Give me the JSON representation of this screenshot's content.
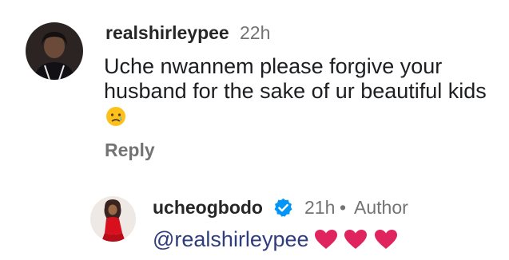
{
  "comment": {
    "username": "realshirleypee",
    "time": "22h",
    "text": "Uche nwannem please forgive your husband for the sake of ur beautiful kids",
    "emoji_icon": "crying-face-icon",
    "reply_label": "Reply"
  },
  "reply": {
    "username": "ucheogbodo",
    "verified_icon": "verified-badge-icon",
    "time": "21h",
    "separator": "•",
    "author_label": "Author",
    "mention": "@realshirleypee",
    "heart_icons": [
      "red-heart-icon",
      "red-heart-icon",
      "red-heart-icon"
    ]
  },
  "colors": {
    "verified": "#0095f6",
    "mention": "#2f3c7e",
    "meta": "#737373",
    "heart": "#e0245e"
  }
}
